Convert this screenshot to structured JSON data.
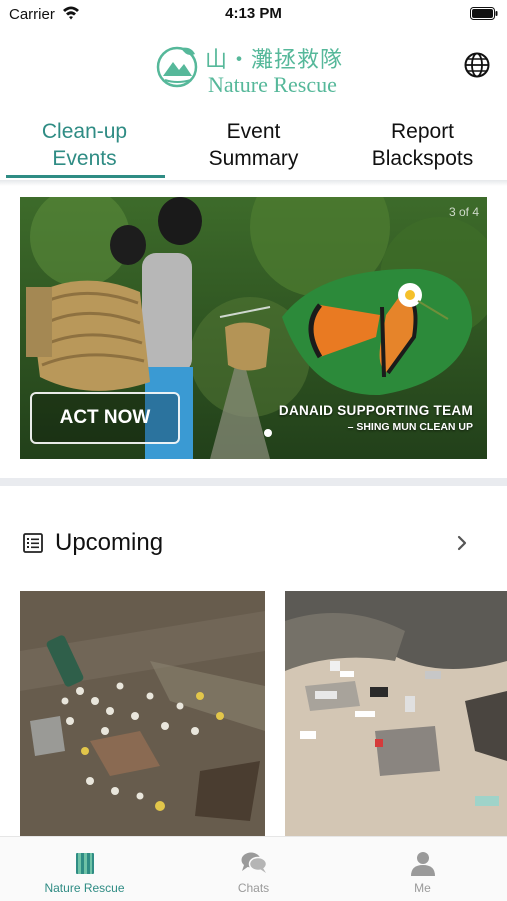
{
  "status_bar": {
    "carrier": "Carrier",
    "time": "4:13 PM"
  },
  "header": {
    "logo_zh": "山・灘拯救隊",
    "logo_en": "Nature Rescue"
  },
  "tabs": [
    {
      "label": "Clean-up\nEvents",
      "active": true
    },
    {
      "label": "Event\nSummary",
      "active": false
    },
    {
      "label": "Report\nBlackspots",
      "active": false
    }
  ],
  "banner": {
    "counter": "3 of 4",
    "cta": "ACT NOW",
    "title": "DANAID SUPPORTING TEAM",
    "subtitle": "– SHING MUN CLEAN UP"
  },
  "upcoming": {
    "title": "Upcoming"
  },
  "bottom_nav": [
    {
      "label": "Nature Rescue",
      "icon": "book-icon",
      "active": true
    },
    {
      "label": "Chats",
      "icon": "chat-bubbles-icon",
      "active": false
    },
    {
      "label": "Me",
      "icon": "person-icon",
      "active": false
    }
  ],
  "colors": {
    "accent": "#2f8c84",
    "logo": "#56b89a",
    "inactive": "#9a9a9a"
  }
}
